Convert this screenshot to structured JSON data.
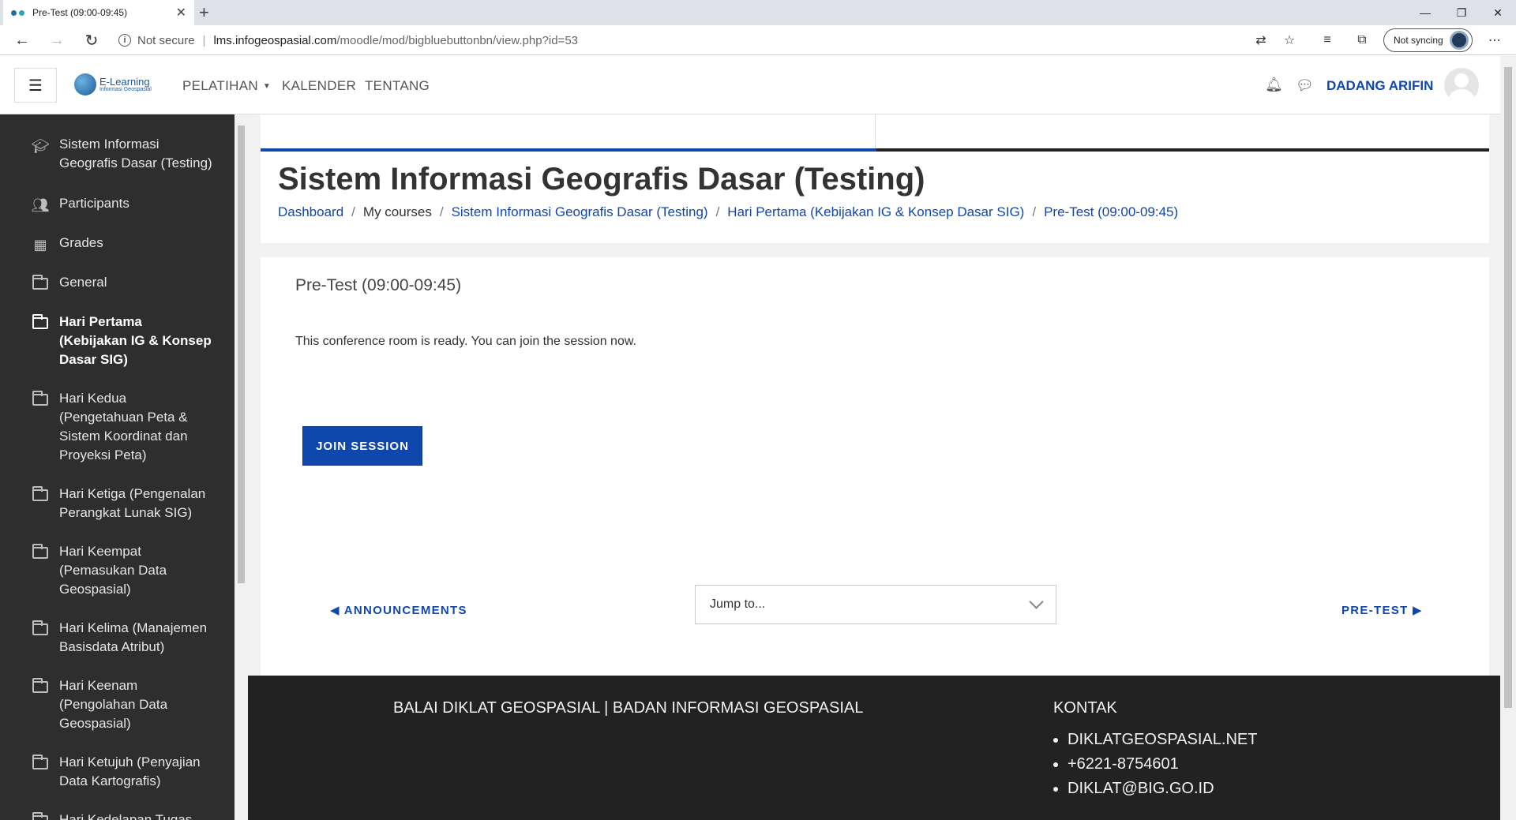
{
  "browser": {
    "tab_title": "Pre-Test (09:00-09:45)",
    "url_security": "Not secure",
    "url_host": "lms.infogeospasial.com",
    "url_path": "/moodle/mod/bigbluebuttonbn/view.php?id=53",
    "sync_label": "Not syncing"
  },
  "navbar": {
    "logo_title": "E-Learning",
    "logo_subtitle": "Informasi Geospasial",
    "menu": [
      "PELATIHAN",
      "KALENDER",
      "TENTANG"
    ],
    "username": "DADANG ARIFIN"
  },
  "sidebar": {
    "items": [
      {
        "label": "Sistem Informasi Geografis Dasar (Testing)",
        "icon": "graduation-cap-icon"
      },
      {
        "label": "Participants",
        "icon": "users-icon"
      },
      {
        "label": "Grades",
        "icon": "table-icon"
      },
      {
        "label": "General",
        "icon": "folder-icon"
      },
      {
        "label": "Hari Pertama (Kebijakan IG & Konsep Dasar SIG)",
        "icon": "folder-icon",
        "active": true
      },
      {
        "label": "Hari Kedua (Pengetahuan Peta & Sistem Koordinat dan Proyeksi Peta)",
        "icon": "folder-icon"
      },
      {
        "label": "Hari Ketiga (Pengenalan Perangkat Lunak SIG)",
        "icon": "folder-icon"
      },
      {
        "label": "Hari Keempat (Pemasukan Data Geospasial)",
        "icon": "folder-icon"
      },
      {
        "label": "Hari Kelima (Manajemen Basisdata Atribut)",
        "icon": "folder-icon"
      },
      {
        "label": "Hari Keenam (Pengolahan Data Geospasial)",
        "icon": "folder-icon"
      },
      {
        "label": "Hari Ketujuh (Penyajian Data Kartografis)",
        "icon": "folder-icon"
      },
      {
        "label": "Hari Kedelapan Tugas",
        "icon": "folder-icon"
      }
    ]
  },
  "header": {
    "title": "Sistem Informasi Geografis Dasar (Testing)",
    "breadcrumb": [
      "Dashboard",
      "My courses",
      "Sistem Informasi Geografis Dasar (Testing)",
      "Hari Pertama (Kebijakan IG & Konsep Dasar SIG)",
      "Pre-Test (09:00-09:45)"
    ]
  },
  "main": {
    "activity_title": "Pre-Test (09:00-09:45)",
    "message": "This conference room is ready. You can join the session now.",
    "join_label": "JOIN SESSION",
    "prev_label": "◀ ANNOUNCEMENTS",
    "next_label": "PRE-TEST ▶",
    "jump_placeholder": "Jump to..."
  },
  "footer": {
    "org": "BALAI DIKLAT GEOSPASIAL | BADAN INFORMASI GEOSPASIAL",
    "contact_heading": "KONTAK",
    "contacts": [
      "DIKLATGEOSPASIAL.NET",
      "+6221-8754601",
      "DIKLAT@BIG.GO.ID"
    ]
  },
  "colors": {
    "accent": "#0f47ad",
    "sidebar_bg": "#2e2e2e",
    "footer_bg": "#222222"
  }
}
